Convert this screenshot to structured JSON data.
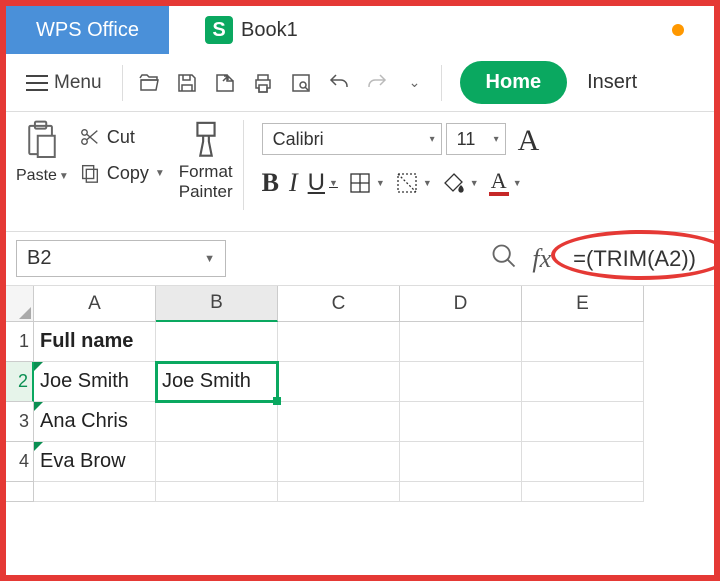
{
  "app": {
    "title": "WPS Office"
  },
  "tab": {
    "glyph": "S",
    "name": "Book1"
  },
  "ribbon": {
    "menu": "Menu",
    "home": "Home",
    "insert": "Insert",
    "paste": "Paste",
    "cut": "Cut",
    "copy": "Copy",
    "format_painter_l1": "Format",
    "format_painter_l2": "Painter"
  },
  "font": {
    "name": "Calibri",
    "size": "11",
    "bold": "B",
    "italic": "I",
    "underline": "U",
    "a_letter": "A",
    "bigA": "A"
  },
  "fxbar": {
    "namebox": "B2",
    "fx_label": "fx",
    "formula": "=(TRIM(A2))"
  },
  "columns": [
    "A",
    "B",
    "C",
    "D",
    "E"
  ],
  "rows": [
    "1",
    "2",
    "3",
    "4"
  ],
  "cells": {
    "A1": "Full name",
    "A2": " Joe Smith",
    "A3": " Ana Chris",
    "A4": " Eva Brow",
    "B2": "Joe Smith"
  }
}
